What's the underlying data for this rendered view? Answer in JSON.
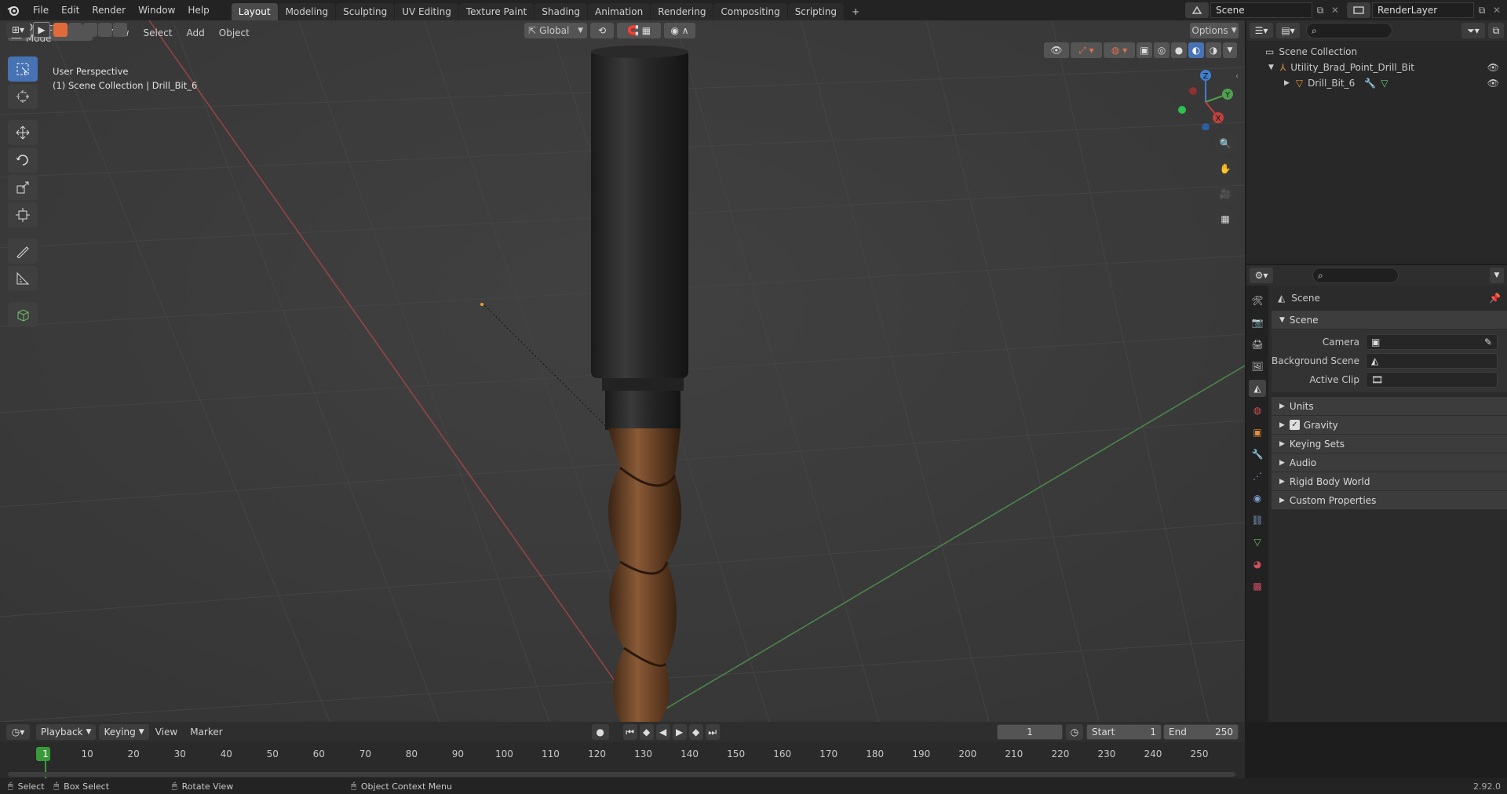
{
  "topbar": {
    "menus": [
      "File",
      "Edit",
      "Render",
      "Window",
      "Help"
    ],
    "workspaces": [
      "Layout",
      "Modeling",
      "Sculpting",
      "UV Editing",
      "Texture Paint",
      "Shading",
      "Animation",
      "Rendering",
      "Compositing",
      "Scripting"
    ],
    "active_workspace": "Layout",
    "scene_name": "Scene",
    "render_layer": "RenderLayer"
  },
  "viewport": {
    "mode": "Object Mode",
    "menus": [
      "View",
      "Select",
      "Add",
      "Object"
    ],
    "transform_orientation": "Global",
    "options_label": "Options",
    "perspective_label": "User Perspective",
    "collection_label": "(1) Scene Collection | Drill_Bit_6",
    "gizmo_axes": [
      "X",
      "Y",
      "Z"
    ]
  },
  "outliner": {
    "root": "Scene Collection",
    "items": [
      {
        "label": "Utility_Brad_Point_Drill_Bit"
      },
      {
        "label": "Drill_Bit_6"
      }
    ]
  },
  "properties": {
    "context_title": "Scene",
    "panel_title": "Scene",
    "fields": [
      {
        "label": "Camera"
      },
      {
        "label": "Background Scene"
      },
      {
        "label": "Active Clip"
      }
    ],
    "subpanels": [
      "Units",
      "Gravity",
      "Keying Sets",
      "Audio",
      "Rigid Body World",
      "Custom Properties"
    ],
    "gravity_checked": true
  },
  "timeline": {
    "menus": [
      "Playback",
      "Keying",
      "View",
      "Marker"
    ],
    "current_frame": "1",
    "start_label": "Start",
    "start": "1",
    "end_label": "End",
    "end": "250",
    "ticks": [
      "1",
      "10",
      "20",
      "30",
      "40",
      "50",
      "60",
      "70",
      "80",
      "90",
      "100",
      "110",
      "120",
      "130",
      "140",
      "150",
      "160",
      "170",
      "180",
      "190",
      "200",
      "210",
      "220",
      "230",
      "240",
      "250"
    ]
  },
  "statusbar": {
    "hints": [
      "Select",
      "Box Select",
      "Rotate View",
      "Object Context Menu"
    ],
    "version": "2.92.0"
  },
  "colors": {
    "accent": "#4772b3",
    "x_axis": "#c04040",
    "y_axis": "#4fa04f",
    "z_axis": "#3f7fd0",
    "frame_marker": "#3a9a3a"
  }
}
